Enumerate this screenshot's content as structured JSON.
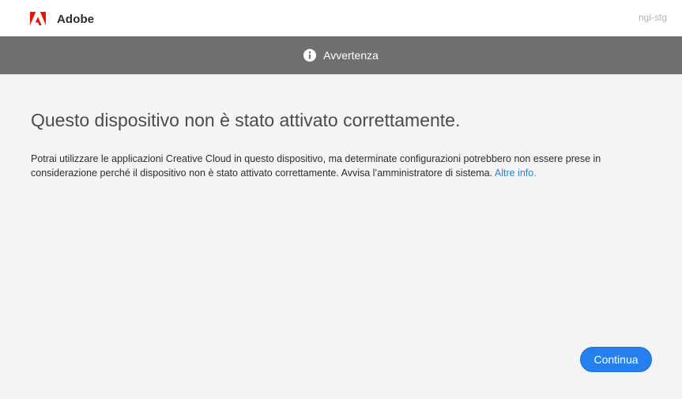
{
  "header": {
    "brand_name": "Adobe",
    "logo_icon": "adobe-logo-icon",
    "env_label": "ngl-stg",
    "brand_color": "#eb1000"
  },
  "banner": {
    "icon": "info-icon",
    "title": "Avvertenza",
    "background": "#707070"
  },
  "main": {
    "heading": "Questo dispositivo non è stato attivato correttamente.",
    "message": "Potrai utilizzare le applicazioni Creative Cloud in questo dispositivo, ma determinate configurazioni potrebbero non essere prese in considerazione perché il dispositivo non è stato attivato correttamente. Avvisa l’amministratore di sistema.",
    "more_link": "Altre info.",
    "link_color": "#2d7fd3"
  },
  "footer": {
    "continue_label": "Continua",
    "button_color": "#2680eb"
  }
}
